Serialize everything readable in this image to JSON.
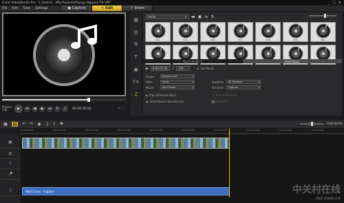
{
  "window": {
    "title": "Corel VideoStudio Pro - C:\\Users\\...\\My Projects\\Flying Hoppers TX VSP",
    "controls": [
      "_",
      "□",
      "×"
    ]
  },
  "menu": [
    "File",
    "Edit",
    "Tools",
    "Settings"
  ],
  "steps": [
    {
      "label": "Capture",
      "icon": "capture-icon"
    },
    {
      "label": "Edit",
      "icon": "edit-icon"
    },
    {
      "label": "Share",
      "icon": "share-icon"
    }
  ],
  "preview": {
    "project_label": "Project",
    "clip_label": "Clip",
    "timecode": "00:00:56:02"
  },
  "categories": [
    "media-icon",
    "instant-project-icon",
    "transition-icon",
    "title-icon",
    "graphic-icon",
    "filter-icon",
    "audio-icon"
  ],
  "library": {
    "filter_value": "Audio",
    "thumb_labels": [
      "M01",
      "M02",
      "M03",
      "M04",
      "M05",
      "M06",
      "M07",
      "M08",
      "M09",
      "M10",
      "M11",
      "M12",
      "M13",
      "M14"
    ],
    "tabs": [
      "Music & Voice",
      "Auto Music"
    ],
    "active_tab": "Auto Music"
  },
  "auto_music": {
    "duration": "0:00:57:24",
    "volume": "100",
    "set_mood_label": "Set Mood",
    "scope_label": "Scope",
    "scope_value": "Royalty Free",
    "filter_label": "Filter",
    "filter_value": "Music",
    "music_label": "Music",
    "music_value": "Wild Chase",
    "subtitles_label": "Subtitles",
    "subtitles_value": "All Versions",
    "variation_label": "Variation",
    "variation_value": "Fugitive",
    "play_selected": "Play Selected Music",
    "smartsound": "SmartSound Quicktracks",
    "add_to_timeline": "Add to Timeline",
    "auto_trim": "Auto Trim"
  },
  "timeline": {
    "duration": "0:00:56:04",
    "ruler_labels": [
      "00:00:00:00",
      "00:00:10:00",
      "00:00:20:00",
      "00:00:30:00",
      "00:00:40:00",
      "00:00:50:00",
      "00:01:00:00",
      "00:01:10:00",
      "00:01:20:00",
      "00:01:30:00"
    ],
    "audio_clip_label": "Wild Chase - Fugitive"
  },
  "watermark": {
    "main": "中关村在线",
    "sub": "zol.com.cn"
  },
  "colors": {
    "accent": "#f5c542",
    "audio_clip": "#3a6ec2"
  }
}
